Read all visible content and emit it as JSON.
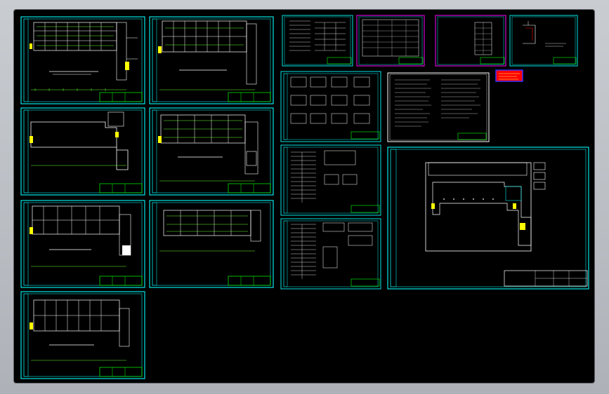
{
  "colors": {
    "background": "#000000",
    "frame": "#00e5e5",
    "title_block": "#00ff00",
    "drawing_lines": "#ffffff",
    "accent_green": "#66ff33",
    "accent_magenta": "#ff00ff",
    "accent_yellow": "#ffff00",
    "accent_red": "#ff0000",
    "accent_blue": "#3333ff"
  },
  "sheets": [
    {
      "id": "floor-plan-1",
      "type": "plan-dense"
    },
    {
      "id": "floor-plan-2",
      "type": "plan-rooms"
    },
    {
      "id": "floor-plan-3",
      "type": "plan-sparse"
    },
    {
      "id": "floor-plan-4",
      "type": "plan-dense"
    },
    {
      "id": "floor-plan-5",
      "type": "plan-rooms"
    },
    {
      "id": "floor-plan-6",
      "type": "plan-dense"
    },
    {
      "id": "floor-plan-7",
      "type": "plan-rooms"
    },
    {
      "id": "schedule-sheet-1",
      "type": "table"
    },
    {
      "id": "schedule-sheet-2",
      "type": "table"
    },
    {
      "id": "schedule-sheet-3",
      "type": "table"
    },
    {
      "id": "detail-sheet",
      "type": "detail"
    },
    {
      "id": "system-diagram-1",
      "type": "schematic"
    },
    {
      "id": "notes-sheet",
      "type": "notes"
    },
    {
      "id": "system-diagram-2",
      "type": "schematic"
    },
    {
      "id": "system-diagram-3",
      "type": "schematic"
    },
    {
      "id": "site-plan",
      "type": "site"
    }
  ]
}
